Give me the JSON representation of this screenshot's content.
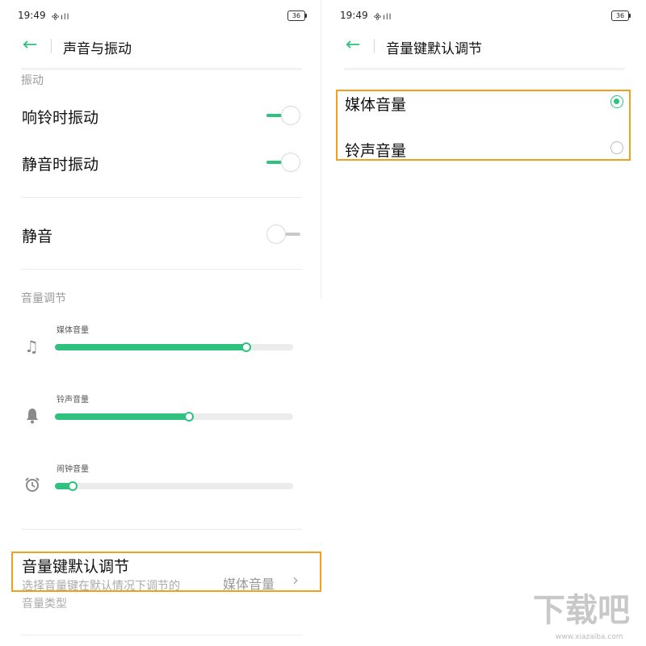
{
  "left": {
    "status": {
      "time": "19:49",
      "signal": "᯽ıll",
      "battery": "36"
    },
    "header": {
      "back": "←",
      "title": "声音与振动"
    },
    "vibration": {
      "section": "振动",
      "ring_vibrate": {
        "label": "响铃时振动",
        "on": true
      },
      "silent_vibrate": {
        "label": "静音时振动",
        "on": true
      }
    },
    "mute": {
      "label": "静音",
      "on": false
    },
    "volume": {
      "section": "音量调节",
      "sliders": [
        {
          "label": "媒体音量",
          "icon": "music-note-icon",
          "glyph": "♫",
          "value": 0.81
        },
        {
          "label": "铃声音量",
          "icon": "bell-icon",
          "glyph": "🔔",
          "value": 0.57
        },
        {
          "label": "闹钟音量",
          "icon": "alarm-clock-icon",
          "glyph": "⏰",
          "value": 0.08
        }
      ]
    },
    "default_adjust": {
      "title": "音量键默认调节",
      "desc1": "选择音量键在默认情况下调节的",
      "desc2": "音量类型",
      "value": "媒体音量",
      "chevron": "›"
    }
  },
  "right": {
    "status": {
      "time": "19:49",
      "signal": "᯽ıll",
      "battery": "36"
    },
    "header": {
      "back": "←",
      "title": "音量键默认调节"
    },
    "options": [
      {
        "label": "媒体音量",
        "selected": true
      },
      {
        "label": "铃声音量",
        "selected": false
      }
    ]
  },
  "colors": {
    "accent": "#2ec27e",
    "highlight": "#f0a020"
  },
  "watermark": {
    "big": "下载吧",
    "small": "www.xiazaiba.com"
  }
}
